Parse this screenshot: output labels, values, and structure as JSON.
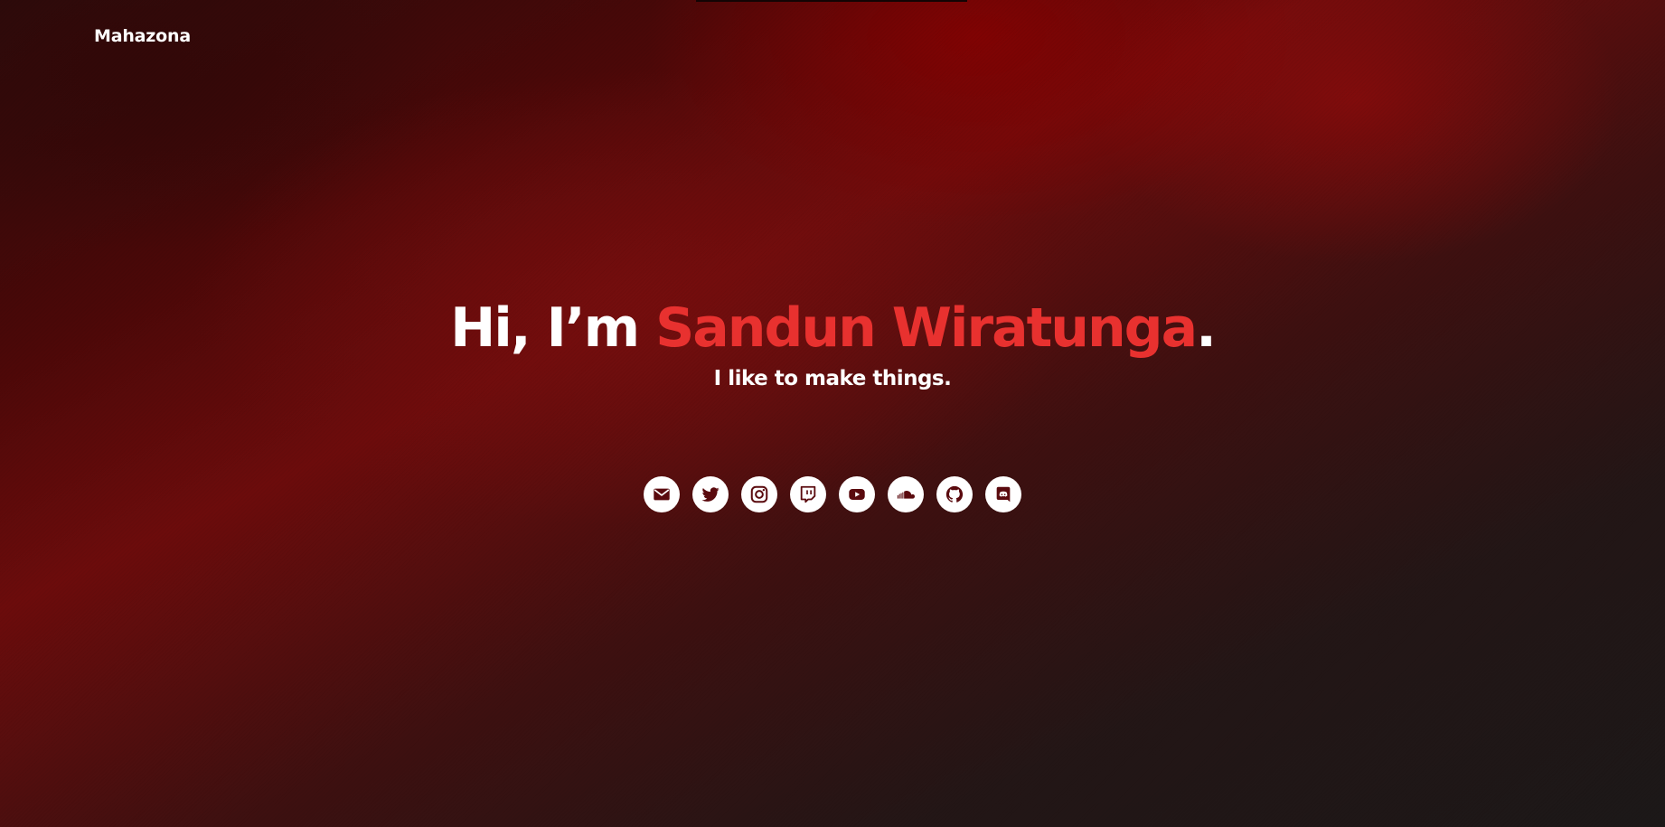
{
  "header": {
    "brand": "Mahazona"
  },
  "hero": {
    "greeting": "Hi, I’m ",
    "name": "Sandun Wiratunga",
    "punctuation": ".",
    "tagline": "I like to make things."
  },
  "socials": [
    {
      "icon": "email-icon"
    },
    {
      "icon": "twitter-icon"
    },
    {
      "icon": "instagram-icon"
    },
    {
      "icon": "twitch-icon"
    },
    {
      "icon": "youtube-icon"
    },
    {
      "icon": "soundcloud-icon"
    },
    {
      "icon": "github-icon"
    },
    {
      "icon": "discord-icon"
    }
  ],
  "colors": {
    "accent": "#e8312f",
    "text": "#ffffff",
    "icon_fg": "#5a0a0e",
    "background": "#1c1717"
  }
}
